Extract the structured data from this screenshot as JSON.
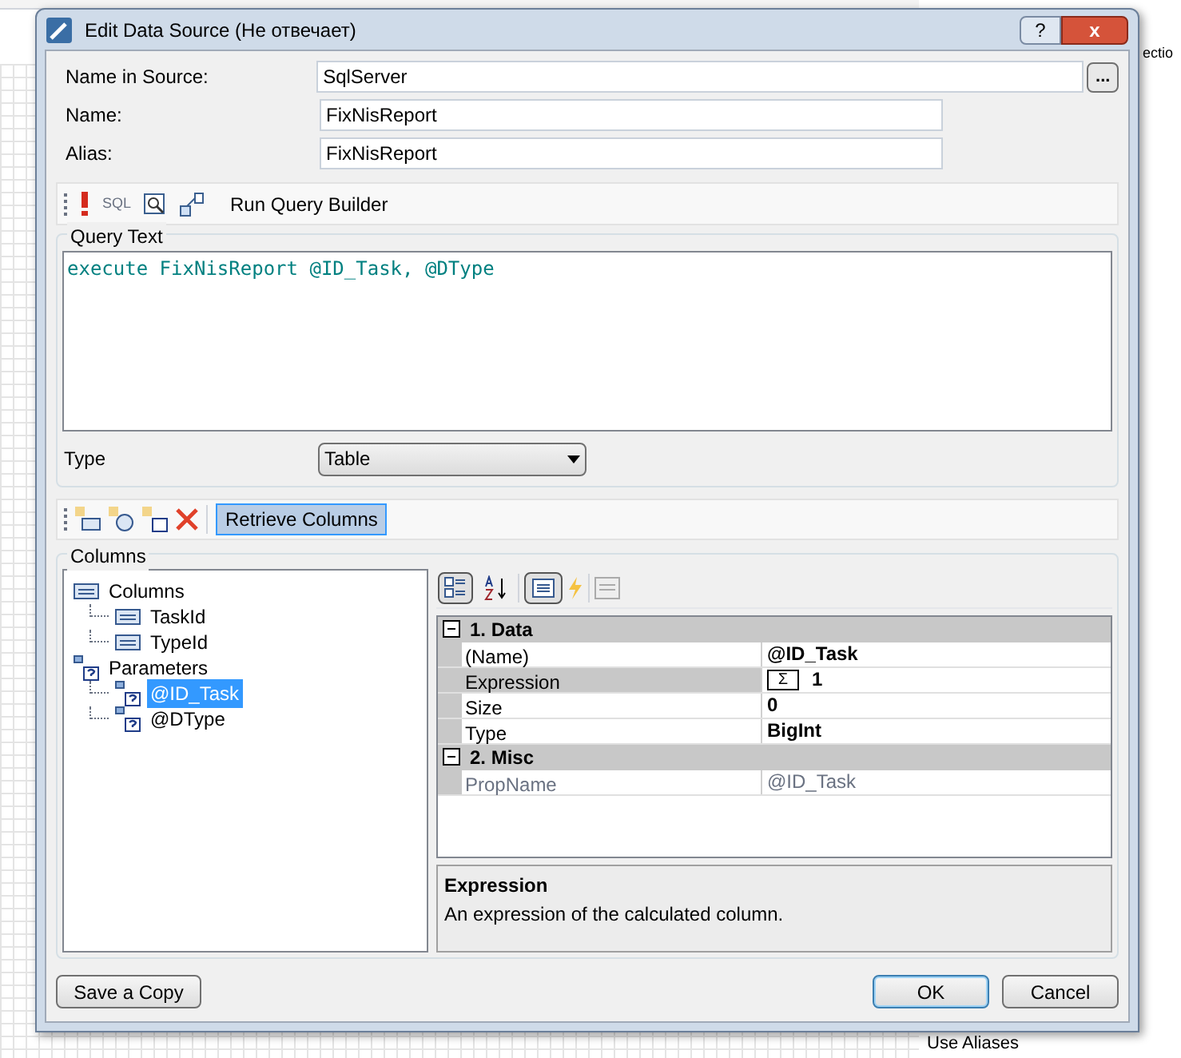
{
  "background": {
    "side_text": "ectio",
    "bottom_text": "Use Aliases"
  },
  "window": {
    "title": "Edit Data Source (Не отвечает)",
    "help_glyph": "?",
    "close_glyph": "x"
  },
  "fields": [
    {
      "label": "Name in Source:",
      "value": "SqlServer",
      "browse": "..."
    },
    {
      "label": "Name:",
      "value": "FixNisReport"
    },
    {
      "label": "Alias:",
      "value": "FixNisReport"
    }
  ],
  "query_toolbar": {
    "sql_label": "SQL",
    "builder_button": "Run Query Builder"
  },
  "query_group": {
    "title": "Query Text",
    "query": "execute FixNisReport @ID_Task, @DType",
    "type_label": "Type",
    "type_value": "Table"
  },
  "columns_toolbar": {
    "retrieve_button": "Retrieve Columns",
    "retrieve_pressed": true
  },
  "columns_group": {
    "title": "Columns",
    "tree": [
      {
        "label": "Columns",
        "kind": "column",
        "selected": false,
        "children": [
          {
            "label": "TaskId",
            "kind": "column",
            "selected": false
          },
          {
            "label": "TypeId",
            "kind": "column",
            "selected": false
          }
        ]
      },
      {
        "label": "Parameters",
        "kind": "parameter",
        "selected": false,
        "children": [
          {
            "label": "@ID_Task",
            "kind": "parameter",
            "selected": true
          },
          {
            "label": "@DType",
            "kind": "parameter",
            "selected": false
          }
        ]
      }
    ],
    "properties": {
      "categorized": true,
      "sections": [
        {
          "title": "1. Data",
          "expanded": true,
          "rows": [
            {
              "name": "(Name)",
              "value": "@ID_Task",
              "selected": false,
              "disabled": false,
              "kind": "text"
            },
            {
              "name": "Expression",
              "value": "1",
              "selected": true,
              "disabled": false,
              "kind": "expression",
              "sigma": "Σ"
            },
            {
              "name": "Size",
              "value": "0",
              "selected": false,
              "disabled": false,
              "kind": "text"
            },
            {
              "name": "Type",
              "value": "BigInt",
              "selected": false,
              "disabled": false,
              "kind": "text"
            }
          ]
        },
        {
          "title": "2. Misc",
          "expanded": true,
          "rows": [
            {
              "name": "PropName",
              "value": "@ID_Task",
              "selected": false,
              "disabled": true,
              "kind": "text"
            }
          ]
        }
      ],
      "help_title": "Expression",
      "help_text": "An expression of the calculated column."
    }
  },
  "buttons": [
    {
      "label": "Save a Copy",
      "default": false
    },
    {
      "label": "OK",
      "default": true
    },
    {
      "label": "Cancel",
      "default": false
    }
  ]
}
